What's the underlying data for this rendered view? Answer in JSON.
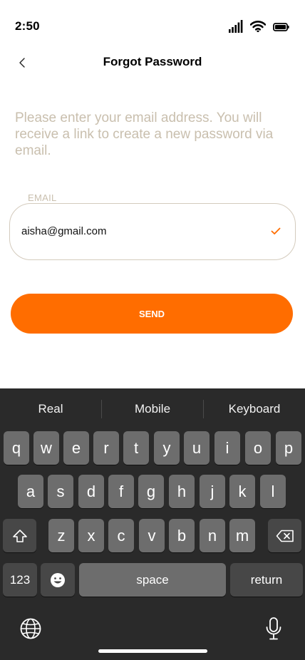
{
  "status": {
    "time": "2:50"
  },
  "nav": {
    "title": "Forgot Password"
  },
  "form": {
    "instructions": "Please enter your email address. You will receive a link to create a new password via email.",
    "email_label": "EMAIL",
    "email_value": "aisha@gmail.com",
    "send_label": "SEND"
  },
  "keyboard": {
    "suggestions": [
      "Real",
      "Mobile",
      "Keyboard"
    ],
    "row1": [
      "q",
      "w",
      "e",
      "r",
      "t",
      "y",
      "u",
      "i",
      "o",
      "p"
    ],
    "row2": [
      "a",
      "s",
      "d",
      "f",
      "g",
      "h",
      "j",
      "k",
      "l"
    ],
    "row3": [
      "z",
      "x",
      "c",
      "v",
      "b",
      "n",
      "m"
    ],
    "numbers_label": "123",
    "space_label": "space",
    "return_label": "return"
  },
  "colors": {
    "accent": "#ff6d00",
    "placeholder_text": "#c9bfae",
    "keyboard_bg": "#2a2a2a",
    "key": "#6d6d6d",
    "key_dark": "#474747"
  },
  "icons": [
    "signal-icon",
    "wifi-icon",
    "battery-icon",
    "back-chevron-icon",
    "check-icon",
    "shift-icon",
    "backspace-icon",
    "emoji-icon",
    "globe-icon",
    "microphone-icon"
  ]
}
